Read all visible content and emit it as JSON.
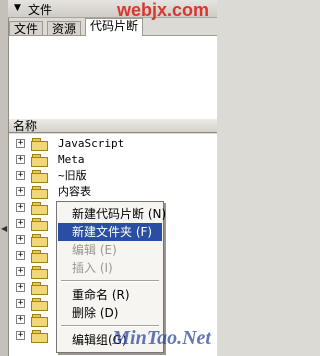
{
  "panel": {
    "title": "文件",
    "collapse_arrow": "▼",
    "grip": "▲"
  },
  "watermark_top": "webjx.com",
  "tabs": [
    {
      "label": "文件"
    },
    {
      "label": "资源"
    },
    {
      "label": "代码片断"
    }
  ],
  "tree": {
    "column_header": "名称",
    "expander_glyph": "+",
    "items": [
      {
        "label": "JavaScript"
      },
      {
        "label": "Meta"
      },
      {
        "label": "~旧版"
      },
      {
        "label": "内容表"
      },
      {
        "label": ""
      },
      {
        "label": ""
      },
      {
        "label": ""
      },
      {
        "label": ""
      },
      {
        "label": ""
      },
      {
        "label": ""
      },
      {
        "label": ""
      },
      {
        "label": ""
      },
      {
        "label": ""
      }
    ]
  },
  "context_menu": {
    "items": [
      {
        "label": "新建代码片断 (N)"
      },
      {
        "label": "新建文件夹 (F)"
      },
      {
        "label": "编辑 (E)"
      },
      {
        "label": "插入 (I)"
      },
      {
        "label": "重命名 (R)"
      },
      {
        "label": "删除 (D)"
      },
      {
        "label": "编辑组(G)"
      }
    ]
  },
  "watermark_bottom": "MinTao.Net",
  "colors": {
    "selection": "#2a4ea3",
    "folder": "#f3d773"
  }
}
